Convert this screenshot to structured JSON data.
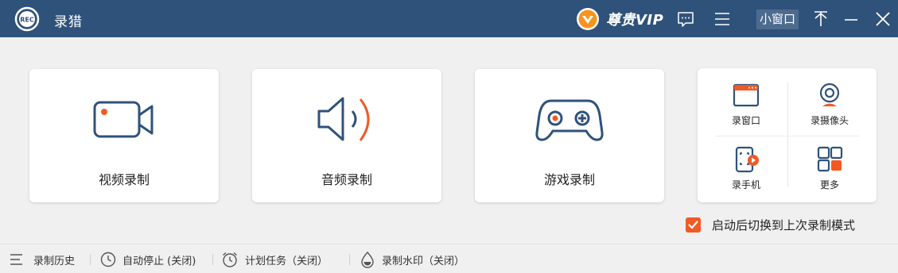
{
  "app": {
    "title": "录猎"
  },
  "header": {
    "vip_label": "尊贵VIP",
    "mini_window_label": "小窗口"
  },
  "cards": [
    {
      "label": "视频录制",
      "icon": "video-camera-icon"
    },
    {
      "label": "音频录制",
      "icon": "speaker-icon"
    },
    {
      "label": "游戏录制",
      "icon": "gamepad-icon"
    }
  ],
  "tools": [
    {
      "label": "录窗口",
      "icon": "window-icon"
    },
    {
      "label": "录摄像头",
      "icon": "webcam-icon"
    },
    {
      "label": "录手机",
      "icon": "phone-icon"
    },
    {
      "label": "更多",
      "icon": "grid-icon"
    }
  ],
  "options": {
    "restore_last_mode_label": "启动后切换到上次录制模式",
    "restore_last_mode_checked": true
  },
  "statusbar": {
    "history": "录制历史",
    "auto_stop": "自动停止 (关闭)",
    "scheduled": "计划任务（关闭）",
    "watermark": "录制水印（关闭）"
  },
  "colors": {
    "titlebar": "#2f527a",
    "accent": "#f15a24",
    "icon_blue": "#2f527a",
    "background": "#f0f0f0"
  }
}
